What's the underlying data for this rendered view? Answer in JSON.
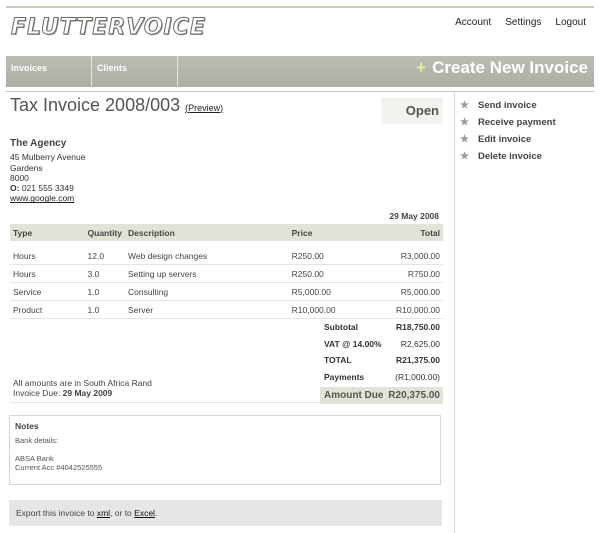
{
  "app": {
    "logo": "FLUTTERVOICE"
  },
  "top_links": [
    "Account",
    "Settings",
    "Logout"
  ],
  "nav": {
    "tabs": [
      "Invoices",
      "Clients"
    ],
    "create_label": "Create New Invoice"
  },
  "invoice": {
    "title": "Tax Invoice 2008/003",
    "preview_label": "Preview",
    "status": "Open",
    "client": {
      "name": "The Agency",
      "address": [
        "45 Mulberry Avenue",
        "Gardens",
        "8000"
      ],
      "phone_label": "O:",
      "phone": "021 555 3349",
      "website": "www.google.com"
    },
    "date": "29 May 2008",
    "columns": [
      "Type",
      "Quantity",
      "Description",
      "Price",
      "Total"
    ],
    "items": [
      [
        "Hours",
        "12.0",
        "Web design changes",
        "R250.00",
        "R3,000.00"
      ],
      [
        "Hours",
        "3.0",
        "Setting up servers",
        "R250.00",
        "R750.00"
      ],
      [
        "Service",
        "1.0",
        "Consulting",
        "R5,000.00",
        "R5,000.00"
      ],
      [
        "Product",
        "1.0",
        "Server",
        "R10,000.00",
        "R10,000.00"
      ]
    ],
    "totals": {
      "subtotal_label": "Subtotal",
      "subtotal": "R18,750.00",
      "vat_label": "VAT @ 14.00%",
      "vat": "R2,625.00",
      "total_label": "TOTAL",
      "total": "R21,375.00",
      "payments_label": "Payments",
      "payments": "(R1,000.00)",
      "due_label": "Amount Due",
      "due": "R20,375.00"
    },
    "currency_note": "All amounts are in South Africa Rand",
    "due_label": "Invoice Due:",
    "due_date": "29 May 2009",
    "notes": {
      "heading": "Notes",
      "bank_label": "Bank details:",
      "lines": [
        "ABSA Bank",
        "Current Acc #4042525555"
      ]
    },
    "export": {
      "prefix": "Export this invoice to",
      "xml": "xml",
      "middle": ", or to",
      "excel": "Excel",
      "suffix": "."
    }
  },
  "sidebar": {
    "actions": [
      "Send invoice",
      "Receive payment",
      "Edit invoice",
      "Delete invoice"
    ]
  },
  "colors": {
    "nav_bg": "#b3b3a9",
    "table_header_bg": "#e2e2d6",
    "create_plus": "#e4f0a0"
  }
}
